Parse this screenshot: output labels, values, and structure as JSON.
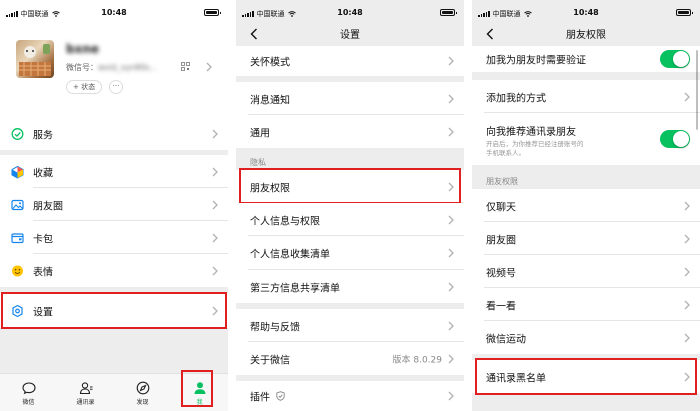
{
  "status": {
    "carrier": "中国联通",
    "time": "10:48"
  },
  "colors": {
    "accent": "#07c160",
    "highlight": "#e02020",
    "background": "#ededed"
  },
  "me": {
    "name": "bxne",
    "wechat_id_label": "微信号：",
    "wechat_id": "wxid_xyn80s...",
    "status_button": "+ 状态",
    "more_button": "···",
    "menu": [
      {
        "label": "服务",
        "icon": "service-icon"
      },
      {
        "label": "收藏",
        "icon": "favorites-icon"
      },
      {
        "label": "朋友圈",
        "icon": "moments-icon"
      },
      {
        "label": "卡包",
        "icon": "card-wallet-icon"
      },
      {
        "label": "表情",
        "icon": "sticker-icon"
      },
      {
        "label": "设置",
        "icon": "settings-gear-icon"
      }
    ],
    "tabs": [
      {
        "label": "微信",
        "icon": "chat-bubble-icon"
      },
      {
        "label": "通讯录",
        "icon": "contacts-icon"
      },
      {
        "label": "发现",
        "icon": "compass-icon"
      },
      {
        "label": "我",
        "icon": "person-icon",
        "active": true
      }
    ]
  },
  "settings": {
    "title": "设置",
    "item_care_mode": "关怀模式",
    "item_notifications": "消息通知",
    "item_general": "通用",
    "section_privacy": "隐私",
    "item_friend_permissions": "朋友权限",
    "item_personal_info": "个人信息与权限",
    "item_info_collection": "个人信息收集清单",
    "item_third_party": "第三方信息共享清单",
    "item_help": "帮助与反馈",
    "item_about": "关于微信",
    "version": "版本 8.0.29",
    "item_plugins": "插件"
  },
  "friend_perm": {
    "title": "朋友权限",
    "item_verify": "加我为朋友时需要验证",
    "item_add_methods": "添加我的方式",
    "item_recommend": "向我推荐通讯录朋友",
    "recommend_desc_1": "开启后，为你推荐已经注册账号的",
    "recommend_desc_2": "手机联系人。",
    "section": "朋友权限",
    "item_chat_only": "仅聊天",
    "item_moments": "朋友圈",
    "item_channels": "视频号",
    "item_wow": "看一看",
    "item_werun": "微信运动",
    "item_blocklist": "通讯录黑名单"
  }
}
